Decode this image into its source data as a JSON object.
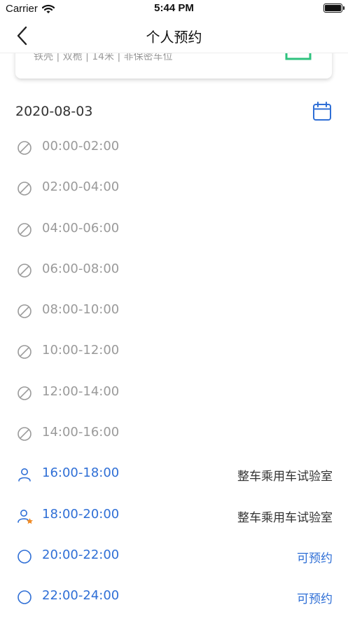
{
  "status_bar": {
    "carrier": "Carrier",
    "time": "5:44 PM",
    "battery_level": 1.0
  },
  "nav": {
    "title": "个人预约"
  },
  "card": {
    "info_line": "铁壳 | 双桅 | 14米 | 非保密车位"
  },
  "date": {
    "value": "2020-08-03"
  },
  "colors": {
    "accent": "#2f6fd6",
    "disabled": "#9a9a9a",
    "star": "#f08a24",
    "card_icon": "#2ec27e"
  },
  "slots": [
    {
      "time": "00:00-02:00",
      "state": "disabled",
      "icon": "no-entry-icon",
      "status": ""
    },
    {
      "time": "02:00-04:00",
      "state": "disabled",
      "icon": "no-entry-icon",
      "status": ""
    },
    {
      "time": "04:00-06:00",
      "state": "disabled",
      "icon": "no-entry-icon",
      "status": ""
    },
    {
      "time": "06:00-08:00",
      "state": "disabled",
      "icon": "no-entry-icon",
      "status": ""
    },
    {
      "time": "08:00-10:00",
      "state": "disabled",
      "icon": "no-entry-icon",
      "status": ""
    },
    {
      "time": "10:00-12:00",
      "state": "disabled",
      "icon": "no-entry-icon",
      "status": ""
    },
    {
      "time": "12:00-14:00",
      "state": "disabled",
      "icon": "no-entry-icon",
      "status": ""
    },
    {
      "time": "14:00-16:00",
      "state": "disabled",
      "icon": "no-entry-icon",
      "status": ""
    },
    {
      "time": "16:00-18:00",
      "state": "booked",
      "icon": "person-icon",
      "status": "整车乘用车试验室"
    },
    {
      "time": "18:00-20:00",
      "state": "booked",
      "icon": "person-star-icon",
      "status": "整车乘用车试验室"
    },
    {
      "time": "20:00-22:00",
      "state": "available",
      "icon": "circle-icon",
      "status": "可预约"
    },
    {
      "time": "22:00-24:00",
      "state": "available",
      "icon": "circle-icon",
      "status": "可预约"
    }
  ]
}
